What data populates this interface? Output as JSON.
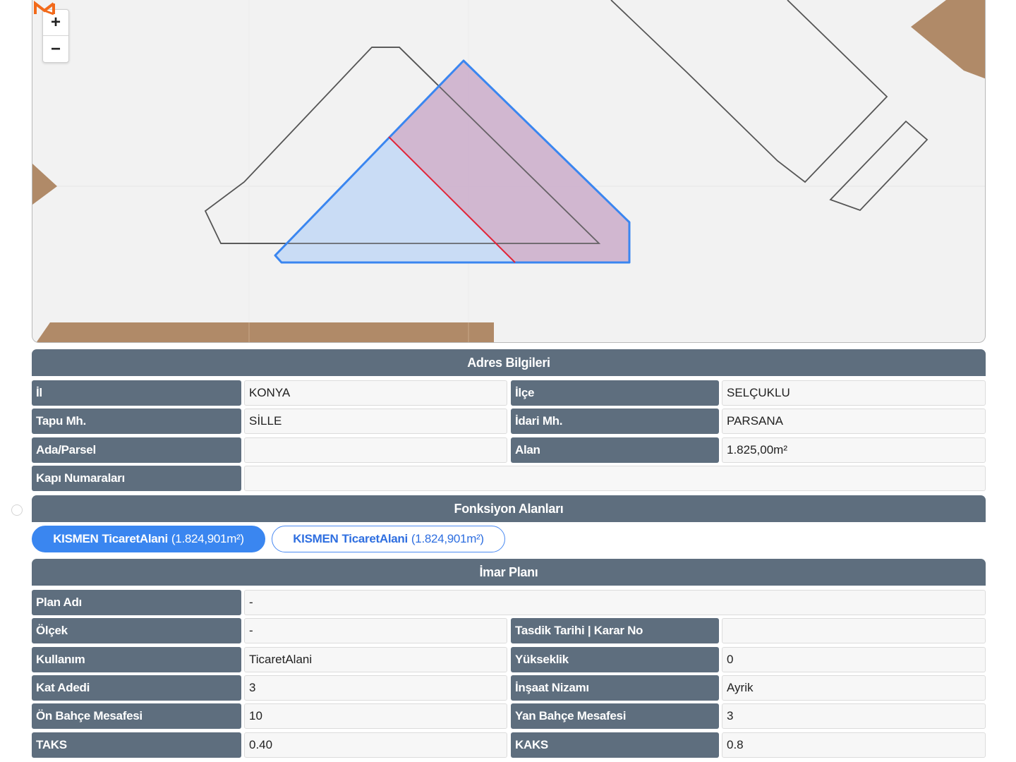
{
  "map": {
    "zoom_in_label": "+",
    "zoom_out_label": "−",
    "colors": {
      "background": "#f2f2f2",
      "parcel_outline": "#3a86f0",
      "parcel_fill": "#c9dcf5",
      "function_area_fill": "#cfb3cd",
      "split_line": "#e0263a",
      "building_outline": "#555555",
      "terrain": "#b08a68"
    }
  },
  "address": {
    "title": "Adres Bilgileri",
    "il_label": "İl",
    "il_value": "KONYA",
    "ilce_label": "İlçe",
    "ilce_value": "SELÇUKLU",
    "tapu_label": "Tapu Mh.",
    "tapu_value": "SİLLE",
    "idari_label": "İdari Mh.",
    "idari_value": "PARSANA",
    "ada_label": "Ada/Parsel",
    "ada_value": "",
    "alan_label": "Alan",
    "alan_value": "1.825,00m²",
    "kapi_label": "Kapı Numaraları",
    "kapi_value": ""
  },
  "functions": {
    "title": "Fonksiyon Alanları",
    "pills": [
      {
        "prefix": "KISMEN",
        "name": "TicaretAlani",
        "area": "(1.824,901m²)",
        "active": true
      },
      {
        "prefix": "KISMEN",
        "name": "TicaretAlani",
        "area": "(1.824,901m²)",
        "active": false
      }
    ]
  },
  "plan": {
    "title": "İmar Planı",
    "plan_adi_label": "Plan Adı",
    "plan_adi_value": "-",
    "olcek_label": "Ölçek",
    "olcek_value": "-",
    "tasdik_label": "Tasdik Tarihi | Karar No",
    "tasdik_value": "",
    "kullanim_label": "Kullanım",
    "kullanim_value": "TicaretAlani",
    "yukseklik_label": "Yükseklik",
    "yukseklik_value": "0",
    "kat_label": "Kat Adedi",
    "kat_value": "3",
    "insaat_label": "İnşaat Nizamı",
    "insaat_value": "Ayrik",
    "on_bahce_label": "Ön Bahçe Mesafesi",
    "on_bahce_value": "10",
    "yan_bahce_label": "Yan Bahçe Mesafesi",
    "yan_bahce_value": "3",
    "taks_label": "TAKS",
    "taks_value": "0.40",
    "kaks_label": "KAKS",
    "kaks_value": "0.8"
  }
}
